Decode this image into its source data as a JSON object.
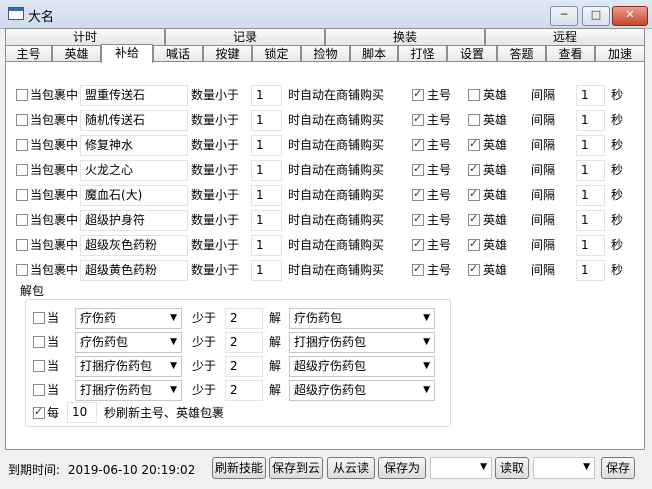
{
  "window": {
    "title": "大名",
    "minimize": "─",
    "maximize": "□",
    "close": "✕"
  },
  "tabs_top": [
    "计时",
    "记录",
    "换装",
    "远程"
  ],
  "tabs_bottom": [
    "主号",
    "英雄",
    "补给",
    "喊话",
    "按键",
    "锁定",
    "捡物",
    "脚本",
    "打怪",
    "设置",
    "答题",
    "查看",
    "加速"
  ],
  "active_tab": "补给",
  "supply": {
    "prefix": "当包裹中",
    "qty_label": "数量小于",
    "buy_label": "时自动在商铺购买",
    "main_label": "主号",
    "hero_label": "英雄",
    "interval_label": "间隔",
    "sec_label": "秒",
    "rows": [
      {
        "item": "盟重传送石",
        "qty": "1",
        "enabled": false,
        "main": true,
        "hero": false,
        "interval": "1"
      },
      {
        "item": "随机传送石",
        "qty": "1",
        "enabled": false,
        "main": true,
        "hero": false,
        "interval": "1"
      },
      {
        "item": "修复神水",
        "qty": "1",
        "enabled": false,
        "main": true,
        "hero": true,
        "interval": "1"
      },
      {
        "item": "火龙之心",
        "qty": "1",
        "enabled": false,
        "main": true,
        "hero": true,
        "interval": "1"
      },
      {
        "item": "魔血石(大)",
        "qty": "1",
        "enabled": false,
        "main": true,
        "hero": true,
        "interval": "1"
      },
      {
        "item": "超级护身符",
        "qty": "1",
        "enabled": false,
        "main": true,
        "hero": true,
        "interval": "1"
      },
      {
        "item": "超级灰色药粉",
        "qty": "1",
        "enabled": false,
        "main": true,
        "hero": true,
        "interval": "1"
      },
      {
        "item": "超级黄色药粉",
        "qty": "1",
        "enabled": false,
        "main": true,
        "hero": true,
        "interval": "1"
      }
    ]
  },
  "unpack": {
    "title": "解包",
    "when_label": "当",
    "less_label": "少于",
    "unpack_label": "解",
    "rows": [
      {
        "source": "疗伤药",
        "count": "2",
        "target": "疗伤药包",
        "enabled": false
      },
      {
        "source": "疗伤药包",
        "count": "2",
        "target": "打捆疗伤药包",
        "enabled": false
      },
      {
        "source": "打捆疗伤药包",
        "count": "2",
        "target": "超级疗伤药包",
        "enabled": false
      },
      {
        "source": "打捆疗伤药包",
        "count": "2",
        "target": "超级疗伤药包",
        "enabled": false
      }
    ],
    "refresh": {
      "enabled": true,
      "prefix": "每",
      "seconds": "10",
      "suffix": "秒刷新主号、英雄包裹"
    }
  },
  "footer": {
    "expiry_label": "到期时间:",
    "expiry_value": "2019-06-10 20:19:02",
    "refresh_skill": "刷新技能",
    "save_cloud": "保存到云",
    "load_cloud": "从云读",
    "save_as": "保存为",
    "read": "读取",
    "save": "保存"
  }
}
